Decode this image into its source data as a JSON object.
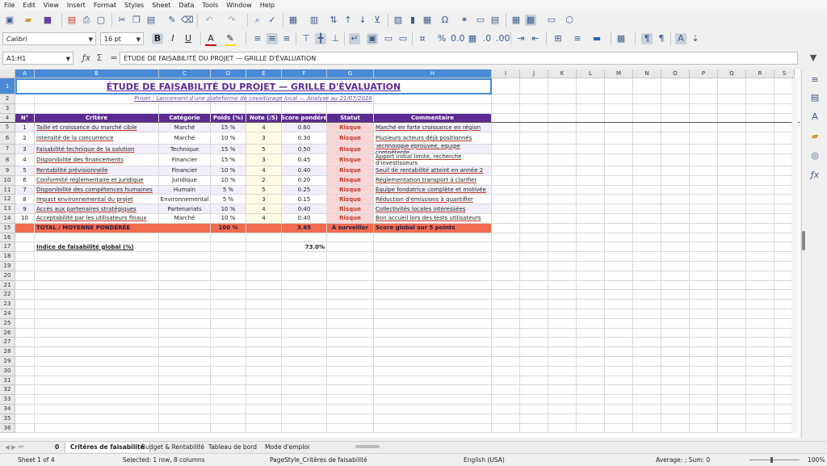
{
  "menu": [
    "File",
    "Edit",
    "View",
    "Insert",
    "Format",
    "Styles",
    "Sheet",
    "Data",
    "Tools",
    "Window",
    "Help"
  ],
  "font": {
    "name": "Calibri",
    "size": "16 pt"
  },
  "namebox": "A1:H1",
  "formula": "ÉTUDE DE FAISABILITÉ DU PROJET — GRILLE D'ÉVALUATION",
  "columns": [
    "A",
    "B",
    "C",
    "D",
    "E",
    "F",
    "G",
    "H",
    "I",
    "J",
    "K",
    "L",
    "M",
    "N",
    "O",
    "P",
    "Q",
    "R",
    "S"
  ],
  "sheet": {
    "title": "ÉTUDE DE FAISABILITÉ DU PROJET — GRILLE D'ÉVALUATION",
    "subtitle": "Projet : Lancement d'une plateforme de covoiturage local — Analyse au 21/07/2026",
    "headers": [
      "N°",
      "Critère",
      "Catégorie",
      "Poids (%)",
      "Note (/5)",
      "Score pondéré",
      "Statut",
      "Commentaire"
    ],
    "rows": [
      [
        "1",
        "Taille et croissance du marché cible",
        "Marché",
        "15 %",
        "4",
        "0.60",
        "Risque",
        "Marché en forte croissance en région"
      ],
      [
        "2",
        "Intensité de la concurrence",
        "Marché",
        "10 %",
        "3",
        "0.30",
        "Risque",
        "Plusieurs acteurs déjà positionnés"
      ],
      [
        "3",
        "Faisabilité technique de la solution",
        "Technique",
        "15 %",
        "5",
        "0.50",
        "Risque",
        "Technologie éprouvée, équipe compétente"
      ],
      [
        "4",
        "Disponibilité des financements",
        "Financier",
        "15 %",
        "3",
        "0.45",
        "Risque",
        "Apport initial limité, recherche d'investisseurs"
      ],
      [
        "5",
        "Rentabilité prévisionnelle",
        "Financier",
        "10 %",
        "4",
        "0.40",
        "Risque",
        "Seuil de rentabilité atteint en année 2"
      ],
      [
        "6",
        "Conformité réglementaire et juridique",
        "Juridique",
        "10 %",
        "2",
        "0.20",
        "Risque",
        "Réglementation transport à clarifier"
      ],
      [
        "7",
        "Disponibilité des compétences humaines",
        "Humain",
        "5 %",
        "5",
        "0.25",
        "Risque",
        "Équipe fondatrice complète et motivée"
      ],
      [
        "8",
        "Impact environnemental du projet",
        "Environnemental",
        "5 %",
        "3",
        "0.15",
        "Risque",
        "Réduction d'émissions à quantifier"
      ],
      [
        "9",
        "Accès aux partenaires stratégiques",
        "Partenariats",
        "10 %",
        "4",
        "0.40",
        "Risque",
        "Collectivités locales intéressées"
      ],
      [
        "10",
        "Acceptabilité par les utilisateurs finaux",
        "Marché",
        "10 %",
        "4",
        "0.40",
        "Risque",
        "Bon accueil lors des tests utilisateurs"
      ]
    ],
    "total": {
      "label": "TOTAL / MOYENNE PONDÉRÉE",
      "weight": "100 %",
      "score": "3.65",
      "status": "À surveiller",
      "comment": "Score global sur 5 points"
    },
    "index": {
      "label": "Indice de faisabilité global (%)",
      "value": "73.0%"
    },
    "row_numbers": [
      "1",
      "2",
      "3",
      "4",
      "5",
      "6",
      "7",
      "8",
      "9",
      "10",
      "11",
      "12",
      "13",
      "14",
      "15",
      "16",
      "17",
      "18",
      "19",
      "20",
      "21",
      "22",
      "23",
      "24",
      "25",
      "26",
      "27",
      "28",
      "29",
      "30",
      "31",
      "32",
      "33",
      "34",
      "35",
      "36"
    ]
  },
  "tabs": {
    "tab_index": "0",
    "active": "Critères de faisabilité",
    "others": [
      "Budget & Rentabilité",
      "Tableau de bord",
      "Mode d'emploi"
    ]
  },
  "status": {
    "sheet": "Sheet 1 of 4",
    "selection": "Selected: 1 row, 8 columns",
    "pagestyle": "PageStyle_Critères de faisabilité",
    "lang": "English (USA)",
    "sum": "Average: ; Sum: 0",
    "zoom": "100%"
  }
}
